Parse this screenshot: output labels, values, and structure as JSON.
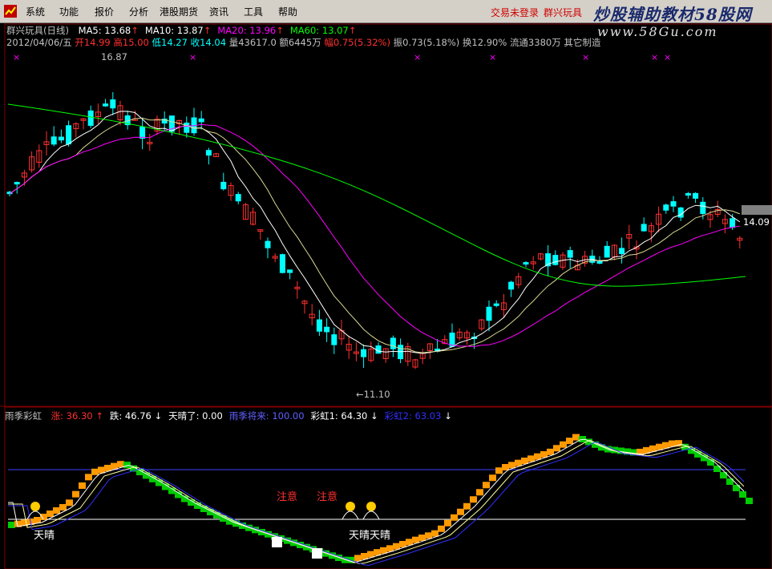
{
  "menubar": {
    "items": [
      "系统",
      "功能",
      "报价",
      "分析",
      "港股期货",
      "资讯",
      "工具",
      "帮助"
    ],
    "login_status": "交易未登录",
    "stock_name": "群兴玩具"
  },
  "watermark": {
    "title": "炒股辅助教材58股网",
    "url": "www.58Gu.com"
  },
  "price_panel": {
    "title": "群兴玩具(日线)",
    "ma": [
      {
        "label": "MA5: 13.68",
        "color": "#ffffff"
      },
      {
        "label": "MA10: 13.87",
        "color": "#ffffff"
      },
      {
        "label": "MA20: 13.96",
        "color": "#ff00ff"
      },
      {
        "label": "MA60: 13.07",
        "color": "#00ff00"
      }
    ],
    "date": "2012/04/06/五",
    "open": "开14.99",
    "high": "高15.00",
    "low": "低14.27",
    "close": "收14.04",
    "volume": "量43617.0",
    "amount": "额6445万",
    "change": "幅0.75(5.32%)",
    "amplitude": "振0.73(5.18%)",
    "turnover": "换12.90%",
    "float": "流通3380万",
    "other": "其它制造",
    "high_marker": "16.87",
    "low_marker": "←11.10",
    "last_price": "14.09"
  },
  "indicator_panel": {
    "title": "雨季彩虹",
    "items": [
      {
        "label": "涨: 36.30",
        "color": "#ff3030",
        "arrow": "↑"
      },
      {
        "label": "跌: 46.76",
        "color": "#ffffff",
        "arrow": "↓"
      },
      {
        "label": "天晴了: 0.00",
        "color": "#ffffff",
        "arrow": ""
      },
      {
        "label": "雨季将来: 100.00",
        "color": "#6060ff",
        "arrow": ""
      },
      {
        "label": "彩虹1: 64.30",
        "color": "#ffffff",
        "arrow": "↓"
      },
      {
        "label": "彩虹2: 63.03",
        "color": "#3030ff",
        "arrow": "↓"
      }
    ],
    "annotations": {
      "warning": "注意",
      "sunny": "天晴",
      "sunny_double": "天晴天晴"
    }
  },
  "colors": {
    "up": "#ff3030",
    "down": "#00ffff",
    "ma5": "#ffffff",
    "ma10": "#ffffff",
    "ma20": "#ff00ff",
    "ma60": "#00ff00",
    "rainbow_up": "#ff9900",
    "rainbow_down": "#00cc00"
  }
}
